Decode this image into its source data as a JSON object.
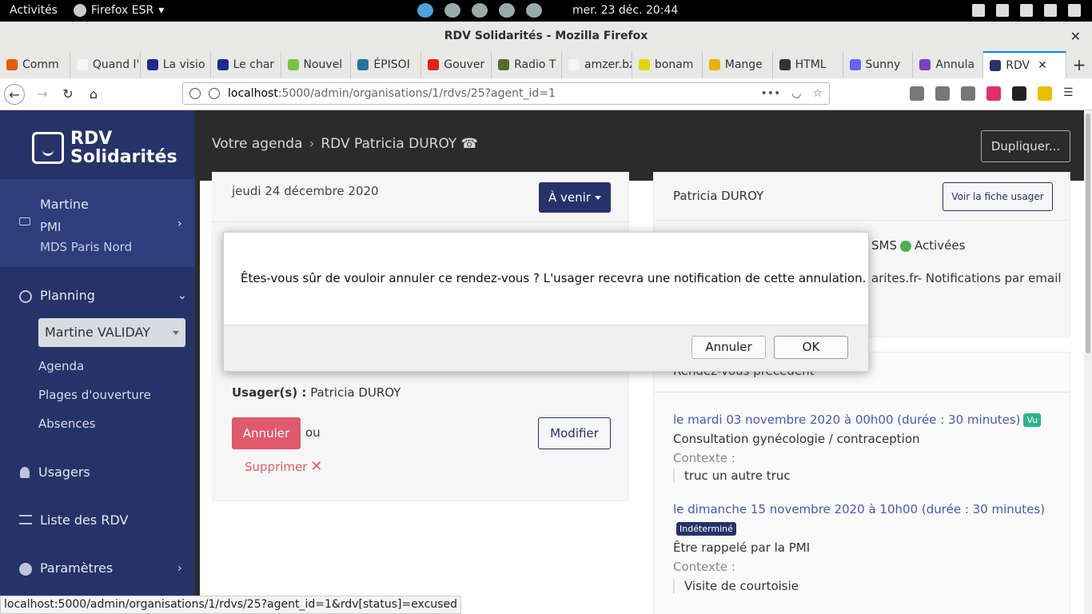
{
  "topbar": {
    "activities": "Activités",
    "app_menu": "Firefox ESR",
    "clock": "mer. 23 déc.  20:44"
  },
  "window": {
    "title": "RDV Solidarités - Mozilla Firefox",
    "close": "✕"
  },
  "tabs": [
    {
      "label": "Comm",
      "color": "#e65c00"
    },
    {
      "label": "Quand l'É",
      "color": "#f5f5f5"
    },
    {
      "label": "La visio",
      "color": "#1f2a8a"
    },
    {
      "label": "Le char",
      "color": "#1f2a8a"
    },
    {
      "label": "Nouvel",
      "color": "#7ac143"
    },
    {
      "label": "ÉPISOI",
      "color": "#21759b"
    },
    {
      "label": "Gouver",
      "color": "#e62117"
    },
    {
      "label": "Radio T",
      "color": "#556b2f"
    },
    {
      "label": "amzer.bzh",
      "color": "#f5f5f5"
    },
    {
      "label": "bonam",
      "color": "#e5d300"
    },
    {
      "label": "Mange",
      "color": "#e5b400"
    },
    {
      "label": "HTML",
      "color": "#333333"
    },
    {
      "label": "Sunny",
      "color": "#6364ff"
    },
    {
      "label": "Annula",
      "color": "#7b3fbf"
    },
    {
      "label": "RDV",
      "color": "#263369",
      "active": true
    }
  ],
  "tab_close": "✕",
  "new_tab": "+",
  "url": {
    "host": "localhost",
    "path": ":5000/admin/organisations/1/rdvs/25?agent_id=1",
    "more": "•••"
  },
  "sidebar": {
    "logo_line1": "RDV",
    "logo_line2": "Solidarités",
    "user_name": "Martine",
    "user_org": "PMI",
    "user_location": "MDS Paris Nord",
    "planning": "Planning",
    "agent_select": "Martine VALIDAY",
    "agenda": "Agenda",
    "plages": "Plages d'ouverture",
    "absences": "Absences",
    "usagers": "Usagers",
    "liste_rdv": "Liste des RDV",
    "parametres": "Paramètres"
  },
  "header": {
    "crumb_root": "Votre agenda",
    "crumb_current": "RDV Patricia DUROY ☎",
    "duplicate": "Dupliquer..."
  },
  "rdv": {
    "date": "jeudi 24 décembre 2020",
    "status": "À venir",
    "usager_label": "Usager(s) :",
    "usager_value": "Patricia DUROY",
    "annuler": "Annuler",
    "ou": "ou",
    "modifier": "Modifier",
    "supprimer": "Supprimer"
  },
  "patient": {
    "name": "Patricia DUROY",
    "fiche": "Voir la fiche usager",
    "notif_sms": "SMS",
    "notif_active": "Activées",
    "notif_email": "arites.fr- Notifications par email"
  },
  "previous": {
    "title": "Rendez-vous précédent",
    "items": [
      {
        "link": "le mardi 03 novembre 2020 à 00h00 (durée : 30 minutes)",
        "badge": "Vu",
        "motif": "Consultation gynécologie / contraception",
        "ctx_label": "Contexte :",
        "ctx_value": "truc un autre truc"
      },
      {
        "link": "le dimanche 15 novembre 2020 à 10h00 (durée : 30 minutes)",
        "badge": "Indéterminé",
        "motif": "Être rappelé par la PMI",
        "ctx_label": "Contexte :",
        "ctx_value": "Visite de courtoisie"
      }
    ]
  },
  "modal": {
    "message": "Êtes-vous sûr de vouloir annuler ce rendez-vous ? L'usager recevra une notification de cette annulation.",
    "cancel": "Annuler",
    "ok": "OK"
  },
  "status_url": "localhost:5000/admin/organisations/1/rdvs/25?agent_id=1&rdv[status]=excused"
}
